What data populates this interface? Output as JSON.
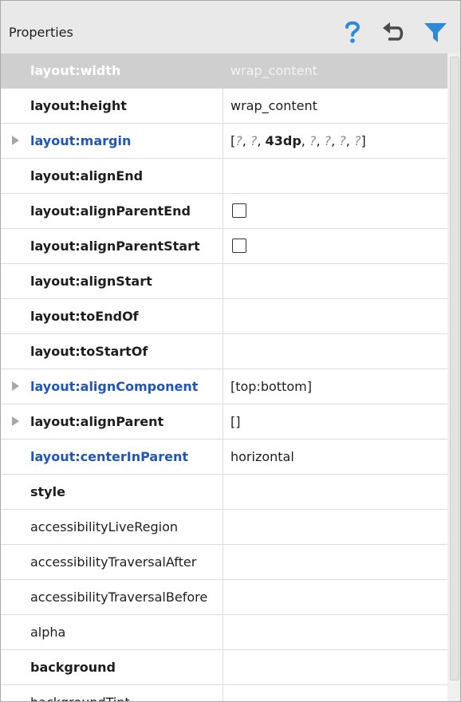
{
  "header": {
    "title": "Properties",
    "help_icon": "question-mark-icon",
    "undo_icon": "undo-icon",
    "filter_icon": "filter-icon",
    "accent_color": "#2e8ad8"
  },
  "rows": [
    {
      "name": "layout:width",
      "value": "wrap_content",
      "bold": true,
      "blue": false,
      "expandable": false,
      "selected": true
    },
    {
      "name": "layout:height",
      "value": "wrap_content",
      "bold": true,
      "blue": false,
      "expandable": false
    },
    {
      "name": "layout:margin",
      "value": "[?, ?, 43dp, ?, ?, ?, ?]",
      "bold": true,
      "blue": true,
      "expandable": true,
      "margin_value": true
    },
    {
      "name": "layout:alignEnd",
      "value": "",
      "bold": true
    },
    {
      "name": "layout:alignParentEnd",
      "bold": true,
      "checkbox": true
    },
    {
      "name": "layout:alignParentStart",
      "bold": true,
      "checkbox": true
    },
    {
      "name": "layout:alignStart",
      "value": "",
      "bold": true
    },
    {
      "name": "layout:toEndOf",
      "value": "",
      "bold": true
    },
    {
      "name": "layout:toStartOf",
      "value": "",
      "bold": true
    },
    {
      "name": "layout:alignComponent",
      "value": "[top:bottom]",
      "bold": true,
      "blue": true,
      "expandable": true
    },
    {
      "name": "layout:alignParent",
      "value": "[]",
      "bold": true,
      "expandable": true
    },
    {
      "name": "layout:centerInParent",
      "value": "horizontal",
      "bold": true,
      "blue": true
    },
    {
      "name": "style",
      "value": "",
      "bold": true
    },
    {
      "name": "accessibilityLiveRegion",
      "value": ""
    },
    {
      "name": "accessibilityTraversalAfter",
      "value": ""
    },
    {
      "name": "accessibilityTraversalBefore",
      "value": ""
    },
    {
      "name": "alpha",
      "value": ""
    },
    {
      "name": "background",
      "value": "",
      "bold": true
    },
    {
      "name": "backgroundTint",
      "value": ""
    }
  ]
}
